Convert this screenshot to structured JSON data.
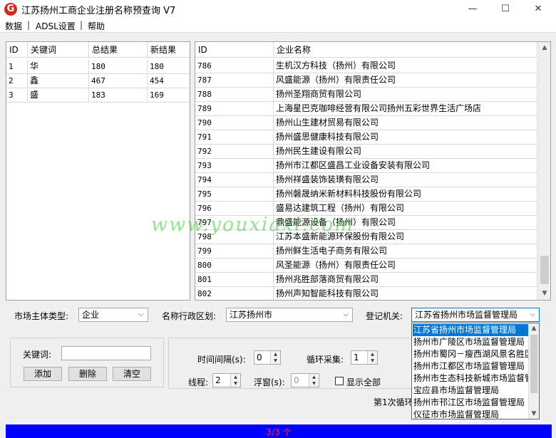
{
  "window": {
    "title": "江苏扬州工商企业注册名称预查询 V7",
    "icon_glyph": "G",
    "minimize": "—",
    "maximize": "☐",
    "close": "✕"
  },
  "menu": {
    "items": [
      "数据",
      "ADSL设置",
      "帮助"
    ],
    "separator": "|"
  },
  "keywords_table": {
    "headers": [
      "ID",
      "关键词",
      "总结果",
      "新结果"
    ],
    "rows": [
      [
        "1",
        "华",
        "180",
        "180"
      ],
      [
        "2",
        "鑫",
        "467",
        "454"
      ],
      [
        "3",
        "盛",
        "183",
        "169"
      ]
    ]
  },
  "results_table": {
    "headers": [
      "ID",
      "企业名称"
    ],
    "rows": [
      [
        "786",
        "生机汉方科技（扬州）有限公司"
      ],
      [
        "787",
        "风盛能源（扬州）有限责任公司"
      ],
      [
        "788",
        "扬州圣翔商贸有限公司"
      ],
      [
        "789",
        "上海星巴克咖啡经营有限公司扬州五彩世界生活广场店"
      ],
      [
        "790",
        "扬州山生建材贸易有限公司"
      ],
      [
        "791",
        "扬州盛思健康科技有限公司"
      ],
      [
        "792",
        "扬州民生建设有限公司"
      ],
      [
        "793",
        "扬州市江都区盛昌工业设备安装有限公司"
      ],
      [
        "794",
        "扬州祥盛装饰装璜有限公司"
      ],
      [
        "795",
        "扬州磐晟纳米新材料科技股份有限公司"
      ],
      [
        "796",
        "盛易达建筑工程（扬州）有限公司"
      ],
      [
        "797",
        "鼎盛能源设备（扬州）有限公司"
      ],
      [
        "798",
        "江苏本盛新能源环保股份有限公司"
      ],
      [
        "799",
        "扬州鲜生活电子商务有限公司"
      ],
      [
        "800",
        "风圣能源（扬州）有限责任公司"
      ],
      [
        "801",
        "扬州兆胜部落商贸有限公司"
      ],
      [
        "802",
        "扬州声知智能科技有限公司"
      ]
    ]
  },
  "filters": {
    "entity_type_label": "市场主体类型:",
    "entity_type_value": "企业",
    "region_label": "名称行政区划:",
    "region_value": "江苏扬州市",
    "authority_label": "登记机关:",
    "authority_value": "江苏省扬州市场监督管理局"
  },
  "authority_options": [
    "江苏省扬州市场监督管理局",
    "扬州市广陵区市场监督管理局",
    "扬州市蜀冈－瘦西湖风景名胜区",
    "扬州市江都区市场监督管理局",
    "扬州市生态科技新城市场监督管",
    "宝应县市场监督管理局",
    "扬州市邗江区市场监督管理局",
    "仪征市市场监督管理局"
  ],
  "keyword_panel": {
    "label": "关键词:",
    "input_value": "",
    "add": "添加",
    "delete": "删除",
    "clear": "清空"
  },
  "settings": {
    "interval_label": "时间间隔(s):",
    "interval_value": "0",
    "loop_label": "循环采集:",
    "loop_value": "1",
    "threads_label": "线程:",
    "threads_value": "2",
    "float_label": "浮窗(s):",
    "float_value": "0",
    "show_all_label": "显示全部",
    "loop_status": "第1次循环"
  },
  "statusbar": {
    "progress_text": "3/3 个",
    "progress": 1.0
  },
  "watermark": "www.youxiaxi.com",
  "colors": {
    "selection": "#0078d7",
    "statusbar": "#0000ff",
    "status_text": "#ff3030",
    "icon_red": "#d12b1f"
  }
}
